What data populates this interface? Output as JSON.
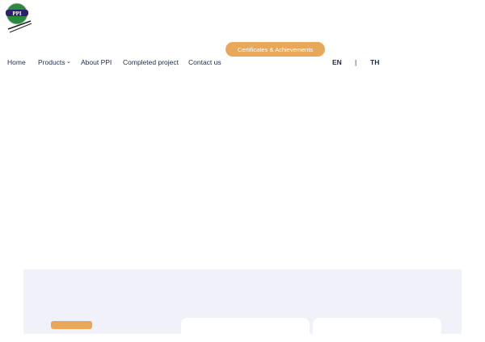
{
  "header": {
    "logo_text": "PPI",
    "cert_button": "Certificates & Achievements"
  },
  "nav": {
    "items": [
      "Home",
      "Products",
      "About PPI",
      "Completed project",
      "Contact us"
    ],
    "chevron": "⌄"
  },
  "lang": {
    "en": "EN",
    "sep": "|",
    "th": "TH"
  },
  "colors": {
    "accent": "#e8a85a",
    "panel": "#f1f1fa"
  }
}
